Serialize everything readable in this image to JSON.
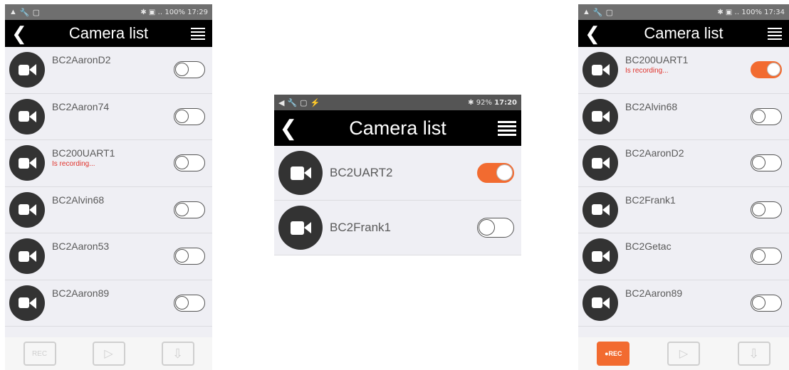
{
  "colors": {
    "accent": "#f26b30",
    "recording": "#e0322b",
    "titlebar": "#000000"
  },
  "left": {
    "status_time": "17:29",
    "status_icons": "✱ ▣ ‥ 100%",
    "title": "Camera list",
    "rows": [
      {
        "name": "BC2AaronD2",
        "status": "",
        "on": false
      },
      {
        "name": "BC2Aaron74",
        "status": "",
        "on": false
      },
      {
        "name": "BC200UART1",
        "status": "Is recording...",
        "on": false
      },
      {
        "name": "BC2Alvin68",
        "status": "",
        "on": false
      },
      {
        "name": "BC2Aaron53",
        "status": "",
        "on": false
      },
      {
        "name": "BC2Aaron89",
        "status": "",
        "on": false
      }
    ],
    "bottom": {
      "rec_label": "REC",
      "play_label": "▷",
      "download_label": "⇩"
    }
  },
  "middle": {
    "status_icons": "✱ 92%",
    "status_time": "17:20",
    "title": "Camera list",
    "rows": [
      {
        "name": "BC2UART2",
        "on": true
      },
      {
        "name": "BC2Frank1",
        "on": false
      }
    ]
  },
  "right": {
    "status_time": "17:34",
    "status_icons": "✱ ▣ ‥ 100%",
    "title": "Camera list",
    "rows": [
      {
        "name": "BC200UART1",
        "status": "Is recording...",
        "on": true
      },
      {
        "name": "BC2Alvin68",
        "status": "",
        "on": false
      },
      {
        "name": "BC2AaronD2",
        "status": "",
        "on": false
      },
      {
        "name": "BC2Frank1",
        "status": "",
        "on": false
      },
      {
        "name": "BC2Getac",
        "status": "",
        "on": false
      },
      {
        "name": "BC2Aaron89",
        "status": "",
        "on": false
      }
    ],
    "bottom": {
      "rec_label": "●REC",
      "play_label": "▷",
      "download_label": "⇩"
    }
  }
}
